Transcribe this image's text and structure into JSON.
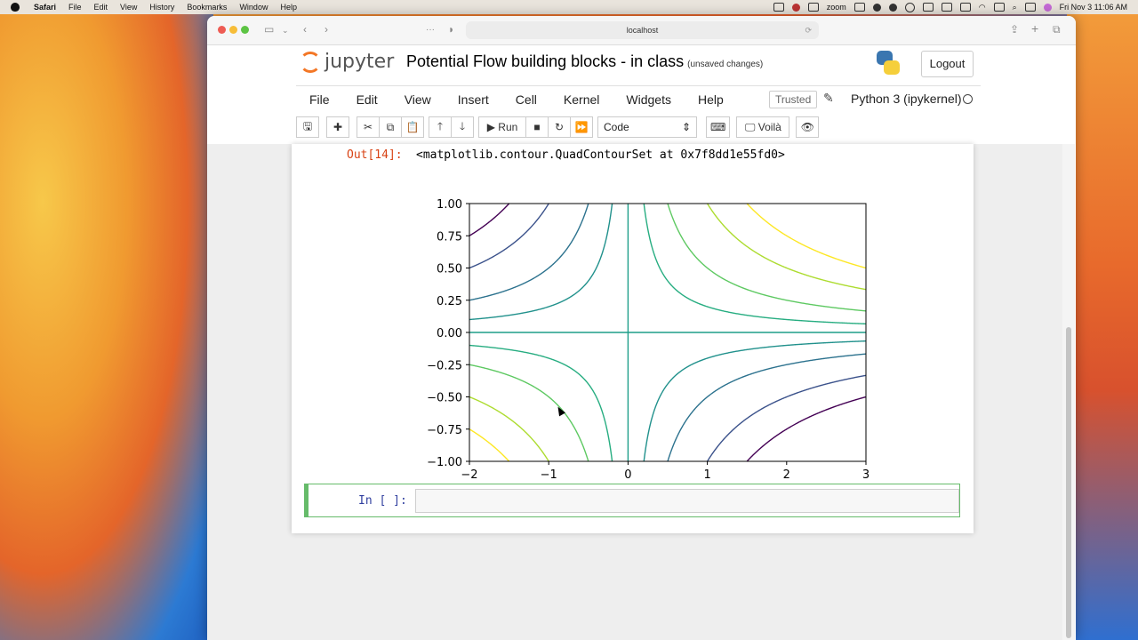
{
  "menubar": {
    "app": "Safari",
    "items": [
      "File",
      "Edit",
      "View",
      "History",
      "Bookmarks",
      "Window",
      "Help"
    ],
    "zoom_label": "zoom",
    "clock": "Fri Nov 3  11:06 AM"
  },
  "browser": {
    "url": "localhost"
  },
  "jupyter": {
    "logo_text": "jupyter",
    "notebook_title": "Potential Flow building blocks - in class",
    "save_status": "(unsaved changes)",
    "logout_label": "Logout",
    "menus": [
      "File",
      "Edit",
      "View",
      "Insert",
      "Cell",
      "Kernel",
      "Widgets",
      "Help"
    ],
    "trusted_label": "Trusted",
    "kernel_name": "Python 3 (ipykernel)",
    "toolbar": {
      "run_label": "Run",
      "cell_type": "Code",
      "voila_label": "Voilà"
    }
  },
  "output": {
    "prompt": "Out[14]:",
    "text": "<matplotlib.contour.QuadContourSet at 0x7f8dd1e55fd0>"
  },
  "input_cell": {
    "prompt": "In [ ]:"
  },
  "chart_data": {
    "type": "contour",
    "function": "x*y",
    "levels": [
      -1.5,
      -1.0,
      -0.5,
      -0.2,
      0.0,
      0.2,
      0.5,
      1.0,
      1.5
    ],
    "xlim": [
      -2,
      3
    ],
    "ylim": [
      -1,
      1
    ],
    "xticks": [
      "−2",
      "−1",
      "0",
      "1",
      "2",
      "3"
    ],
    "yticks": [
      "1.00",
      "0.75",
      "0.50",
      "0.25",
      "0.00",
      "−0.25",
      "−0.50",
      "−0.75",
      "−1.00"
    ],
    "level_colors": [
      "#440154",
      "#3b528b",
      "#2c728e",
      "#21918c",
      "#1f9e89",
      "#27ad81",
      "#5ec962",
      "#addc30",
      "#fde725"
    ],
    "title": "",
    "xlabel": "",
    "ylabel": ""
  }
}
